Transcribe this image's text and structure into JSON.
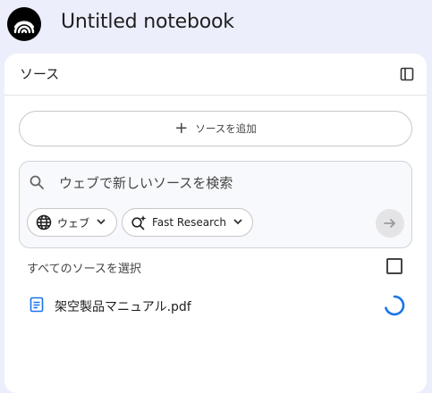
{
  "app": {
    "title": "Untitled notebook"
  },
  "sources_panel": {
    "title": "ソース",
    "add_source_label": "ソースを追加",
    "search": {
      "placeholder": "ウェブで新しいソースを検索",
      "source_type_chip": "ウェブ",
      "research_mode_chip": "Fast Research"
    },
    "select_all_label": "すべてのソースを選択",
    "select_all_checked": false,
    "items": [
      {
        "name": "架空製品マニュアル.pdf",
        "icon": "document-icon",
        "status": "loading"
      }
    ]
  },
  "colors": {
    "background": "#eceffb",
    "accent_blue": "#1a73e8"
  }
}
